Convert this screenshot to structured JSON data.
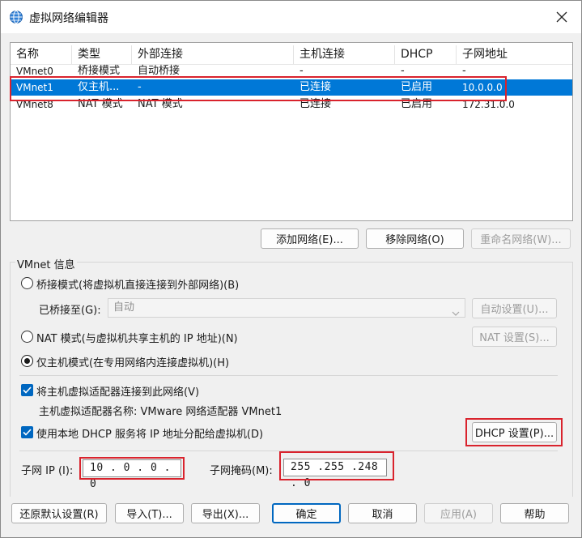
{
  "window": {
    "title": "虚拟网络编辑器"
  },
  "list": {
    "headers": [
      "名称",
      "类型",
      "外部连接",
      "主机连接",
      "DHCP",
      "子网地址"
    ],
    "rows": [
      {
        "name": "VMnet0",
        "type": "桥接模式",
        "external": "自动桥接",
        "host": "-",
        "dhcp": "-",
        "subnet": "-"
      },
      {
        "name": "VMnet1",
        "type": "仅主机...",
        "external": "-",
        "host": "已连接",
        "dhcp": "已启用",
        "subnet": "10.0.0.0"
      },
      {
        "name": "VMnet8",
        "type": "NAT 模式",
        "external": "NAT 模式",
        "host": "已连接",
        "dhcp": "已启用",
        "subnet": "172.31.0.0"
      }
    ]
  },
  "list_buttons": {
    "add": "添加网络(E)...",
    "remove": "移除网络(O)",
    "rename": "重命名网络(W)..."
  },
  "info": {
    "group_label": "VMnet 信息",
    "bridge_label": "桥接模式(将虚拟机直接连接到外部网络)(B)",
    "bridged_to_label": "已桥接至(G):",
    "bridged_to_value": "自动",
    "auto_settings": "自动设置(U)...",
    "nat_label": "NAT 模式(与虚拟机共享主机的 IP 地址)(N)",
    "nat_settings": "NAT 设置(S)...",
    "hostonly_label": "仅主机模式(在专用网络内连接虚拟机)(H)",
    "connect_adapter_label": "将主机虚拟适配器连接到此网络(V)",
    "adapter_name_label": "主机虚拟适配器名称: VMware 网络适配器 VMnet1",
    "dhcp_label": "使用本地 DHCP 服务将 IP 地址分配给虚拟机(D)",
    "dhcp_settings": "DHCP 设置(P)...",
    "subnet_ip_label": "子网 IP (I):",
    "subnet_ip_value": "10 . 0 . 0 . 0",
    "subnet_mask_label": "子网掩码(M):",
    "subnet_mask_value": "255 .255 .248 . 0"
  },
  "footer": {
    "restore": "还原默认设置(R)",
    "import": "导入(T)...",
    "export": "导出(X)...",
    "ok": "确定",
    "cancel": "取消",
    "apply": "应用(A)",
    "help": "帮助"
  },
  "colors": {
    "selection": "#0078d7",
    "highlight_box": "#d9232d",
    "checkbox": "#0067c0"
  }
}
